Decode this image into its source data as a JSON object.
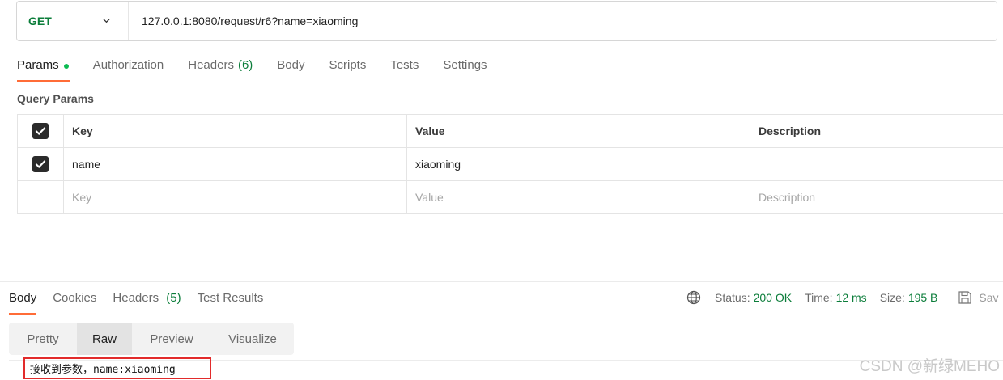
{
  "request": {
    "method": "GET",
    "url": "127.0.0.1:8080/request/r6?name=xiaoming"
  },
  "request_tabs": [
    {
      "label": "Params",
      "active": true
    },
    {
      "label": "Authorization"
    },
    {
      "label": "Headers",
      "count": "(6)"
    },
    {
      "label": "Body"
    },
    {
      "label": "Scripts"
    },
    {
      "label": "Tests"
    },
    {
      "label": "Settings"
    }
  ],
  "query_params": {
    "title": "Query Params",
    "headers": {
      "key": "Key",
      "value": "Value",
      "description": "Description"
    },
    "rows": [
      {
        "key": "name",
        "value": "xiaoming",
        "description": "",
        "checked": true
      }
    ],
    "placeholder": {
      "key": "Key",
      "value": "Value",
      "description": "Description"
    }
  },
  "response_tabs": [
    {
      "label": "Body",
      "active": true
    },
    {
      "label": "Cookies"
    },
    {
      "label": "Headers",
      "count": "(5)"
    },
    {
      "label": "Test Results"
    }
  ],
  "status": {
    "status_label": "Status:",
    "status_value": "200 OK",
    "time_label": "Time:",
    "time_value": "12 ms",
    "size_label": "Size:",
    "size_value": "195 B",
    "save_label": "Sav"
  },
  "body_modes": [
    {
      "label": "Pretty"
    },
    {
      "label": "Raw",
      "active": true
    },
    {
      "label": "Preview"
    },
    {
      "label": "Visualize"
    }
  ],
  "response_body": "接收到参数，name:xiaoming",
  "watermark": "CSDN @新绿MEHO",
  "colors": {
    "accent": "#ff6c37",
    "success": "#0b7d3a",
    "highlight_border": "#e22b2b"
  }
}
